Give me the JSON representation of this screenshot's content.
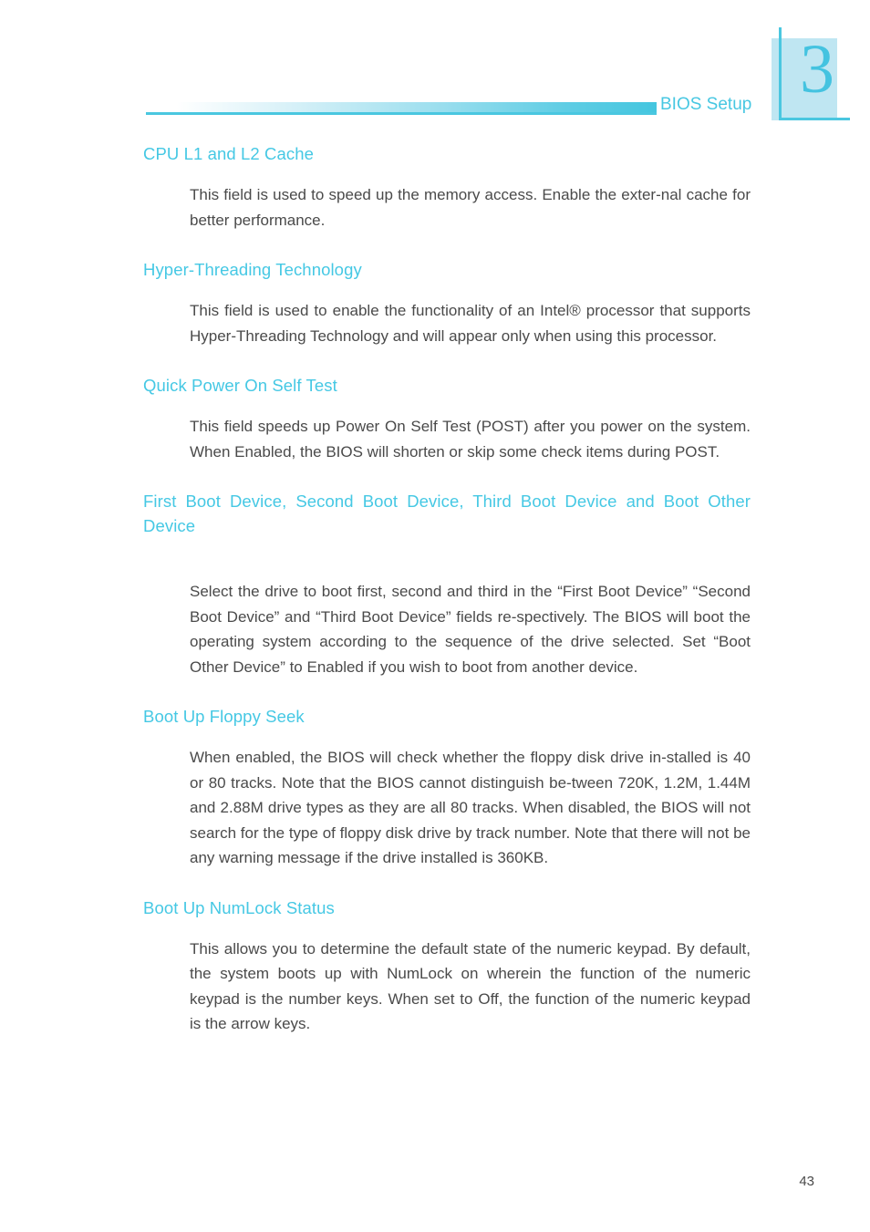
{
  "document": {
    "header": {
      "title": "BIOS Setup",
      "chapter_number": "3",
      "accent_color": "#4ac7e0",
      "heading_color": "#45c8e4",
      "chapter_block_color": "#bfe6f2"
    },
    "footer": {
      "page_number": "43"
    },
    "sections": [
      {
        "heading": "CPU L1 and  L2 Cache",
        "body": "This field is used to speed up the memory access. Enable the exter-nal cache for better performance."
      },
      {
        "heading": "Hyper-Threading Technology",
        "body": "This field is used to enable the functionality of an Intel® processor that supports Hyper-Threading Technology and will appear only when using this processor."
      },
      {
        "heading": "Quick Power On Self Test",
        "body": "This field speeds up Power On Self Test (POST) after you power on the system. When Enabled, the BIOS will shorten or skip some check items during POST."
      },
      {
        "heading": "First Boot Device, Second Boot Device, Third Boot Device and Boot Other Device",
        "body": "Select the drive to boot first, second and third in the “First Boot Device” “Second Boot Device” and “Third Boot Device” fields re-spectively. The BIOS will boot the operating system according to the sequence of the drive selected. Set “Boot Other Device” to Enabled if you wish to boot from another device."
      },
      {
        "heading": "Boot Up Floppy Seek",
        "body": "When enabled, the BIOS will check whether the floppy disk drive in-stalled is 40 or 80 tracks. Note that the BIOS cannot distinguish be-tween 720K, 1.2M, 1.44M and 2.88M drive types as they are all 80 tracks. When disabled, the BIOS will not search for the type of floppy disk drive by track number. Note that there will not be any warning message if the drive installed is 360KB."
      },
      {
        "heading": "Boot Up NumLock Status",
        "body": "This allows you to determine the default state of the numeric keypad. By default, the system boots up with NumLock on wherein the function of the numeric keypad is the number keys. When set to Off, the function of the numeric keypad is the arrow keys."
      }
    ]
  }
}
